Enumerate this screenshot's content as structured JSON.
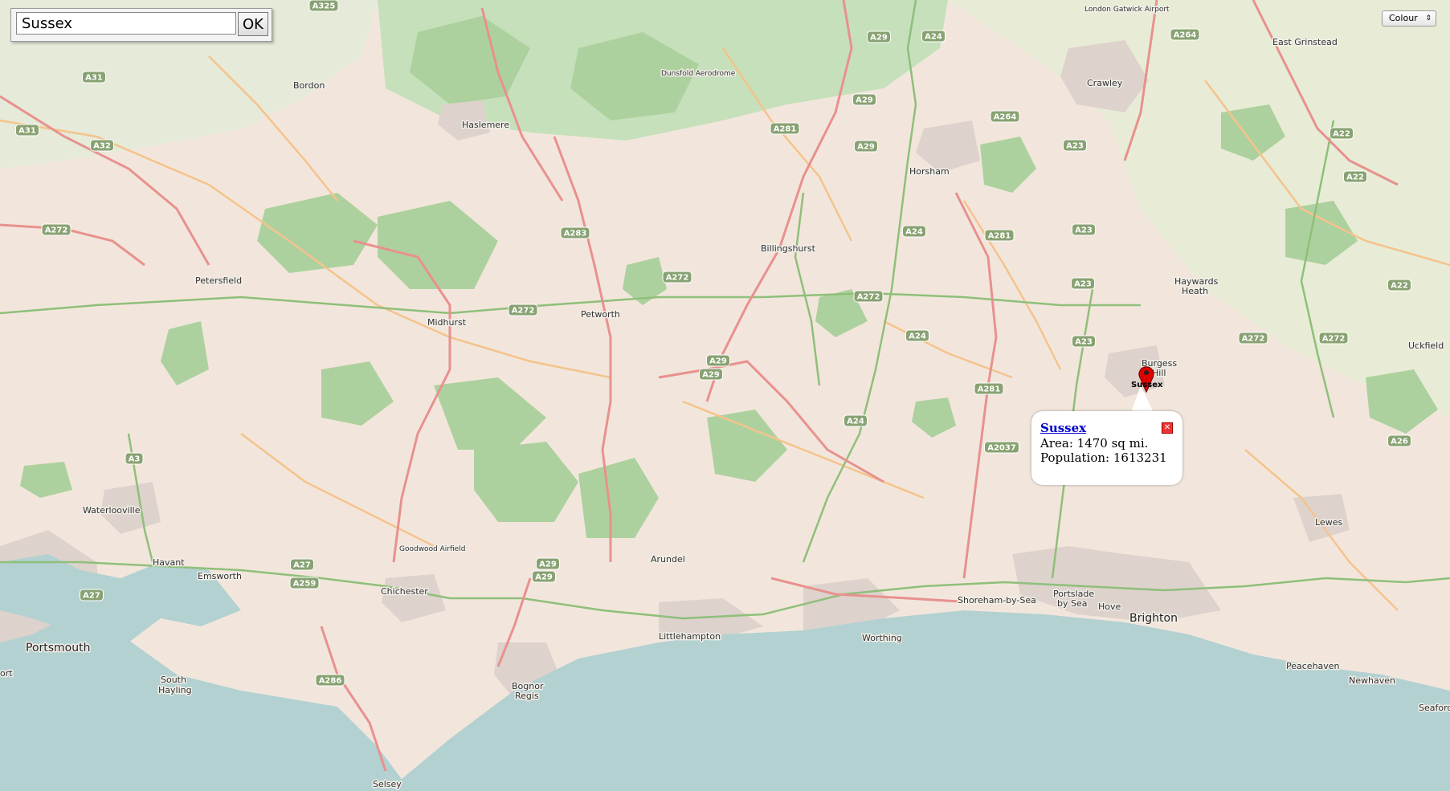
{
  "search": {
    "value": "Sussex",
    "button_label": "OK"
  },
  "style_selector": {
    "selected": "Colour"
  },
  "popup": {
    "title": "Sussex",
    "area_line": "Area: 1470 sq mi.",
    "population_line": "Population: 1613231",
    "close_symbol": "✕"
  },
  "marker": {
    "label": "Sussex"
  },
  "places": {
    "london_gatwick_airport": "London Gatwick Airport",
    "east_grinstead": "East Grinstead",
    "crawley": "Crawley",
    "bordon": "Bordon",
    "dunsfold_aerodrome": "Dunsfold Aerodrome",
    "haslemere": "Haslemere",
    "horsham": "Horsham",
    "billingshurst": "Billingshurst",
    "petersfield": "Petersfield",
    "midhurst": "Midhurst",
    "petworth": "Petworth",
    "haywards": "Haywards",
    "heath": "Heath",
    "burgess": "Burgess",
    "hill": "Hill",
    "uckfield": "Uckfield",
    "waterlooville": "Waterlooville",
    "havant": "Havant",
    "emsworth": "Emsworth",
    "goodwood_airfield": "Goodwood Airfield",
    "chichester": "Chichester",
    "arundel": "Arundel",
    "lewes": "Lewes",
    "portsmouth": "Portsmouth",
    "littlehampton": "Littlehampton",
    "worthing": "Worthing",
    "shoreham_by_sea": "Shoreham-by-Sea",
    "portslade": "Portslade",
    "by_sea": "by Sea",
    "hove": "Hove",
    "brighton": "Brighton",
    "south": "South",
    "hayling": "Hayling",
    "bognor": "Bognor",
    "regis": "Regis",
    "peacehaven": "Peacehaven",
    "newhaven": "Newhaven",
    "seaford": "Seaford",
    "selsey": "Selsey",
    "ort": "ort"
  },
  "roads": [
    "A325",
    "A29",
    "A24",
    "A264",
    "A31",
    "A32",
    "A281",
    "A264",
    "A22",
    "A23",
    "A272",
    "A283",
    "A272",
    "A24",
    "A281",
    "A3",
    "A24",
    "A27",
    "A259",
    "A29",
    "A29",
    "A286",
    "A2037",
    "A26",
    "A22",
    "A272",
    "A281",
    "A24",
    "A23",
    "A23",
    "A29",
    "A29",
    "A31",
    "A27",
    "A22",
    "A272",
    "A23",
    "A272",
    "A272",
    "A29",
    "A29"
  ],
  "colors": {
    "land": "#f2e6dc",
    "sea": "#b3d1d1",
    "forest": "#add19e",
    "road_primary": "#e8918e",
    "road_secondary": "#f5c38c",
    "road_green": "#8fbf7a",
    "shield": "#88a272",
    "popup_link": "#0000cc",
    "marker": "#e00000"
  }
}
